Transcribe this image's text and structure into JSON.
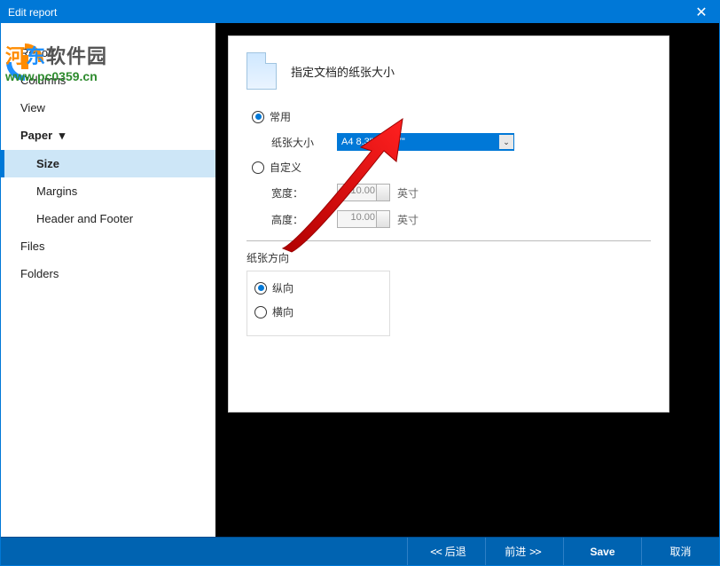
{
  "window": {
    "title": "Edit report",
    "close": "✕"
  },
  "watermark": {
    "brand_prefix": "河",
    "brand_mid": "东",
    "brand_suffix": "软件园",
    "url": "www.pc0359.cn"
  },
  "sidebar": {
    "items": [
      {
        "label": "Report"
      },
      {
        "label": "Columns"
      },
      {
        "label": "View"
      },
      {
        "label": "Paper",
        "expanded": true,
        "children": [
          {
            "label": "Size",
            "selected": true
          },
          {
            "label": "Margins"
          },
          {
            "label": "Header and Footer"
          }
        ]
      },
      {
        "label": "Files"
      },
      {
        "label": "Folders"
      }
    ],
    "expand_glyph": "▾"
  },
  "content": {
    "heading": "指定文档的纸张大小",
    "common_radio": "常用",
    "paper_size_label": "纸张大小",
    "paper_size_value": "A4 8.3\" x 11.7\"",
    "custom_radio": "自定义",
    "width_label": "宽度：",
    "width_value": "10.00",
    "height_label": "高度：",
    "height_value": "10.00",
    "unit": "英寸",
    "orientation_title": "纸张方向",
    "portrait": "纵向",
    "landscape": "横向"
  },
  "buttons": {
    "back": "后退",
    "back_arrows": "<<",
    "forward": "前进",
    "forward_arrows": ">>",
    "save": "Save",
    "cancel": "取消"
  }
}
